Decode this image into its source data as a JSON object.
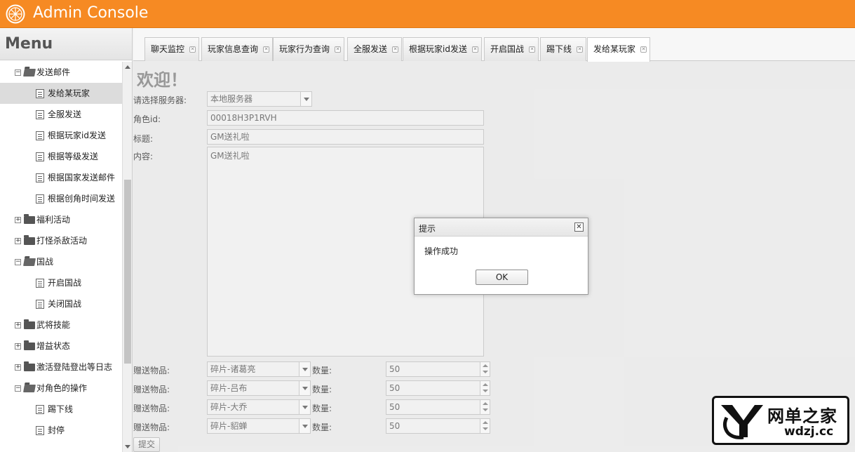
{
  "header": {
    "title": "Admin Console",
    "brand_color": "#f68a23"
  },
  "sidebar": {
    "title": "Menu",
    "items": [
      {
        "label": "发送邮件",
        "type": "folder",
        "expanded": true,
        "level": 0
      },
      {
        "label": "发给某玩家",
        "type": "doc",
        "level": 1,
        "selected": true
      },
      {
        "label": "全服发送",
        "type": "doc",
        "level": 1
      },
      {
        "label": "根据玩家id发送",
        "type": "doc",
        "level": 1
      },
      {
        "label": "根据等级发送",
        "type": "doc",
        "level": 1
      },
      {
        "label": "根据国家发送邮件",
        "type": "doc",
        "level": 1
      },
      {
        "label": "根据创角时间发送",
        "type": "doc",
        "level": 1
      },
      {
        "label": "福利活动",
        "type": "folder",
        "expanded": false,
        "level": 0
      },
      {
        "label": "打怪杀敌活动",
        "type": "folder",
        "expanded": false,
        "level": 0
      },
      {
        "label": "国战",
        "type": "folder",
        "expanded": true,
        "level": 0
      },
      {
        "label": "开启国战",
        "type": "doc",
        "level": 1
      },
      {
        "label": "关闭国战",
        "type": "doc",
        "level": 1
      },
      {
        "label": "武将技能",
        "type": "folder",
        "expanded": false,
        "level": 0
      },
      {
        "label": "增益状态",
        "type": "folder",
        "expanded": false,
        "level": 0
      },
      {
        "label": "激活登陆登出等日志",
        "type": "folder",
        "expanded": false,
        "level": 0
      },
      {
        "label": "对角色的操作",
        "type": "folder",
        "expanded": true,
        "level": 0
      },
      {
        "label": "踢下线",
        "type": "doc",
        "level": 1
      },
      {
        "label": "封停",
        "type": "doc",
        "level": 1
      }
    ]
  },
  "tabs": [
    {
      "label": "聊天监控",
      "active": false
    },
    {
      "label": "玩家信息查询",
      "active": false
    },
    {
      "label": "玩家行为查询",
      "active": false
    },
    {
      "label": "全服发送",
      "active": false
    },
    {
      "label": "根据玩家id发送",
      "active": false
    },
    {
      "label": "开启国战",
      "active": false
    },
    {
      "label": "踢下线",
      "active": false
    },
    {
      "label": "发给某玩家",
      "active": true
    }
  ],
  "form": {
    "welcome": "欢迎！",
    "server_label": "请选择服务器:",
    "server_value": "本地服务器",
    "role_id_label": "角色id:",
    "role_id_value": "00018H3P1RVH",
    "subject_label": "标题:",
    "subject_value": "GM送礼啦",
    "content_label": "内容:",
    "content_value": "GM送礼啦",
    "gifts": [
      {
        "label": "赠送物品:",
        "item": "碎片-诸葛亮",
        "qty_label": "数量:",
        "qty": "50"
      },
      {
        "label": "赠送物品:",
        "item": "碎片-吕布",
        "qty_label": "数量:",
        "qty": "50"
      },
      {
        "label": "赠送物品:",
        "item": "碎片-大乔",
        "qty_label": "数量:",
        "qty": "50"
      },
      {
        "label": "赠送物品:",
        "item": "碎片-貂蝉",
        "qty_label": "数量:",
        "qty": "50"
      }
    ],
    "submit_label": "提交"
  },
  "dialog": {
    "title": "提示",
    "message": "操作成功",
    "ok_label": "OK",
    "close_glyph": "✕"
  },
  "watermark": {
    "main": "网单之家",
    "sub": "wdzj.cc"
  }
}
